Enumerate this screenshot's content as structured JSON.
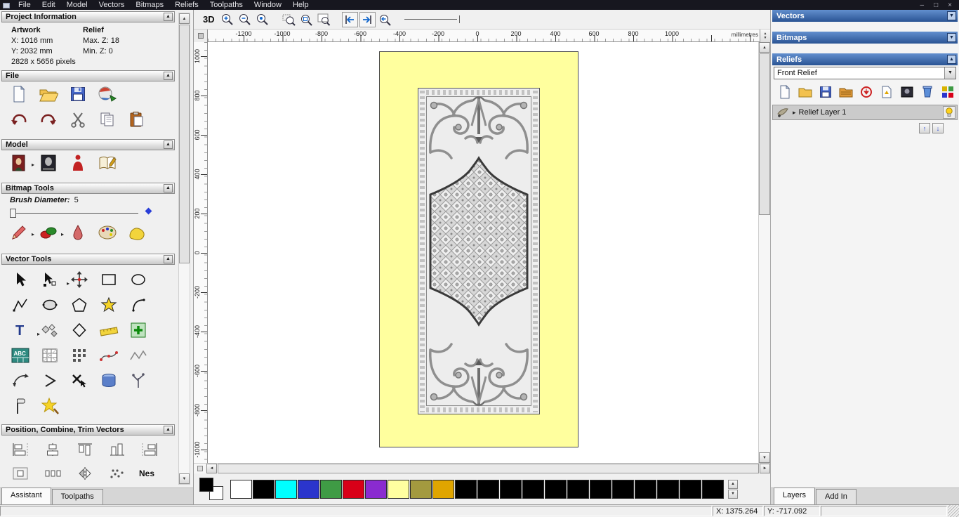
{
  "menu": {
    "items": [
      "File",
      "Edit",
      "Model",
      "Vectors",
      "Bitmaps",
      "Reliefs",
      "Toolpaths",
      "Window",
      "Help"
    ]
  },
  "window_controls": {
    "minimize": "–",
    "maximize": "□",
    "close": "×"
  },
  "left_panel": {
    "sections": {
      "project_information": "Project Information",
      "file": "File",
      "model": "Model",
      "bitmap_tools": "Bitmap Tools",
      "vector_tools": "Vector Tools",
      "position": "Position, Combine, Trim Vectors"
    },
    "project_info": {
      "artwork_label": "Artwork",
      "relief_label": "Relief",
      "x": "X: 1016 mm",
      "y": "Y: 2032 mm",
      "max_z": "Max. Z: 18",
      "min_z": "Min. Z: 0",
      "pixels": "2828 x 5656 pixels"
    },
    "brush": {
      "label": "Brush Diameter:",
      "value": "5"
    },
    "tabs": {
      "assistant": "Assistant",
      "toolpaths": "Toolpaths"
    }
  },
  "toolbar": {
    "view_3d": "3D"
  },
  "rulers": {
    "horizontal": [
      "-1200",
      "-1000",
      "-800",
      "-600",
      "-400",
      "-200",
      "0",
      "200",
      "400",
      "600",
      "800",
      "1000"
    ],
    "vertical": [
      "1000",
      "800",
      "600",
      "400",
      "200",
      "0",
      "-200",
      "-400",
      "-600",
      "-800",
      "-1000"
    ],
    "units": "millimetres"
  },
  "palette": {
    "primary": "#000000",
    "secondary": "#ffffff",
    "swatches": [
      "#ffffff",
      "#000000",
      "#00ffff",
      "#2b35cc",
      "#3f9b45",
      "#d80018",
      "#8a2bd0",
      "#ffffa0",
      "#a39a3f",
      "#e0a500",
      "#000000",
      "#000000",
      "#000000",
      "#000000",
      "#000000",
      "#000000",
      "#000000",
      "#000000",
      "#000000",
      "#000000",
      "#000000",
      "#000000"
    ]
  },
  "right_panel": {
    "headers": {
      "vectors": "Vectors",
      "bitmaps": "Bitmaps",
      "reliefs": "Reliefs"
    },
    "relief_select": {
      "value": "Front Relief"
    },
    "layers": [
      {
        "name": "Relief Layer 1"
      }
    ],
    "tabs": {
      "layers": "Layers",
      "add_in": "Add In"
    }
  },
  "status_bar": {
    "x": "X: 1375.264",
    "y": "Y: -717.092"
  },
  "icons": {
    "collapse": "▲",
    "dropdown": "▼",
    "up": "▲",
    "down": "▼",
    "left": "◄",
    "right": "►",
    "expand": "▸",
    "move_up": "↑",
    "move_down": "↓"
  },
  "glyphs": {
    "text_tool": "T",
    "abc": "ABC",
    "nest": "Nes"
  }
}
